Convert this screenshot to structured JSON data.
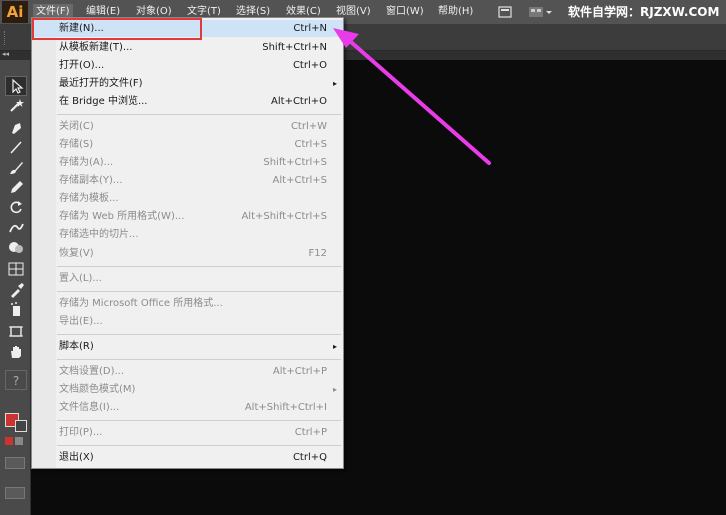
{
  "menubar": {
    "logo": "Ai",
    "items": [
      "文件(F)",
      "编辑(E)",
      "对象(O)",
      "文字(T)",
      "选择(S)",
      "效果(C)",
      "视图(V)",
      "窗口(W)",
      "帮助(H)"
    ],
    "watermark": "软件自学网：RJZXW.COM"
  },
  "file_menu": {
    "items": [
      {
        "label": "新建(N)...",
        "shortcut": "Ctrl+N",
        "disabled": false
      },
      {
        "label": "从模板新建(T)...",
        "shortcut": "Shift+Ctrl+N",
        "disabled": false
      },
      {
        "label": "打开(O)...",
        "shortcut": "Ctrl+O",
        "disabled": false
      },
      {
        "label": "最近打开的文件(F)",
        "shortcut": "",
        "disabled": false,
        "submenu": true
      },
      {
        "label": "在 Bridge 中浏览...",
        "shortcut": "Alt+Ctrl+O",
        "disabled": false
      },
      {
        "label": "关闭(C)",
        "shortcut": "Ctrl+W",
        "disabled": true
      },
      {
        "label": "存储(S)",
        "shortcut": "Ctrl+S",
        "disabled": true
      },
      {
        "label": "存储为(A)...",
        "shortcut": "Shift+Ctrl+S",
        "disabled": true
      },
      {
        "label": "存储副本(Y)...",
        "shortcut": "Alt+Ctrl+S",
        "disabled": true
      },
      {
        "label": "存储为模板...",
        "shortcut": "",
        "disabled": true
      },
      {
        "label": "存储为 Web 所用格式(W)...",
        "shortcut": "Alt+Shift+Ctrl+S",
        "disabled": true
      },
      {
        "label": "存储选中的切片...",
        "shortcut": "",
        "disabled": true
      },
      {
        "label": "恢复(V)",
        "shortcut": "F12",
        "disabled": true
      },
      {
        "label": "置入(L)...",
        "shortcut": "",
        "disabled": true
      },
      {
        "label": "存储为 Microsoft Office 所用格式...",
        "shortcut": "",
        "disabled": true
      },
      {
        "label": "导出(E)...",
        "shortcut": "",
        "disabled": true
      },
      {
        "label": "脚本(R)",
        "shortcut": "",
        "disabled": false,
        "submenu": true
      },
      {
        "label": "文档设置(D)...",
        "shortcut": "Alt+Ctrl+P",
        "disabled": true
      },
      {
        "label": "文档颜色模式(M)",
        "shortcut": "",
        "disabled": true,
        "submenu": true
      },
      {
        "label": "文件信息(I)...",
        "shortcut": "Alt+Shift+Ctrl+I",
        "disabled": true
      },
      {
        "label": "打印(P)...",
        "shortcut": "Ctrl+P",
        "disabled": true
      },
      {
        "label": "退出(X)",
        "shortcut": "Ctrl+Q",
        "disabled": false
      }
    ],
    "submenu_arrow": "▸"
  },
  "tools": [
    "selection-tool",
    "magic-wand-tool",
    "pen-tool",
    "line-tool",
    "paintbrush-tool",
    "pencil-tool",
    "rotate-tool",
    "warp-tool",
    "shape-builder-tool",
    "gradient-tool",
    "eyedropper-tool",
    "symbol-sprayer-tool",
    "artboard-tool",
    "hand-tool"
  ],
  "tool_glyphs": {
    "help": "?"
  },
  "colors": {
    "highlight_box": "#e23a3a",
    "arrow": "#e83ce8",
    "menu_bg": "#f0f0f0"
  }
}
